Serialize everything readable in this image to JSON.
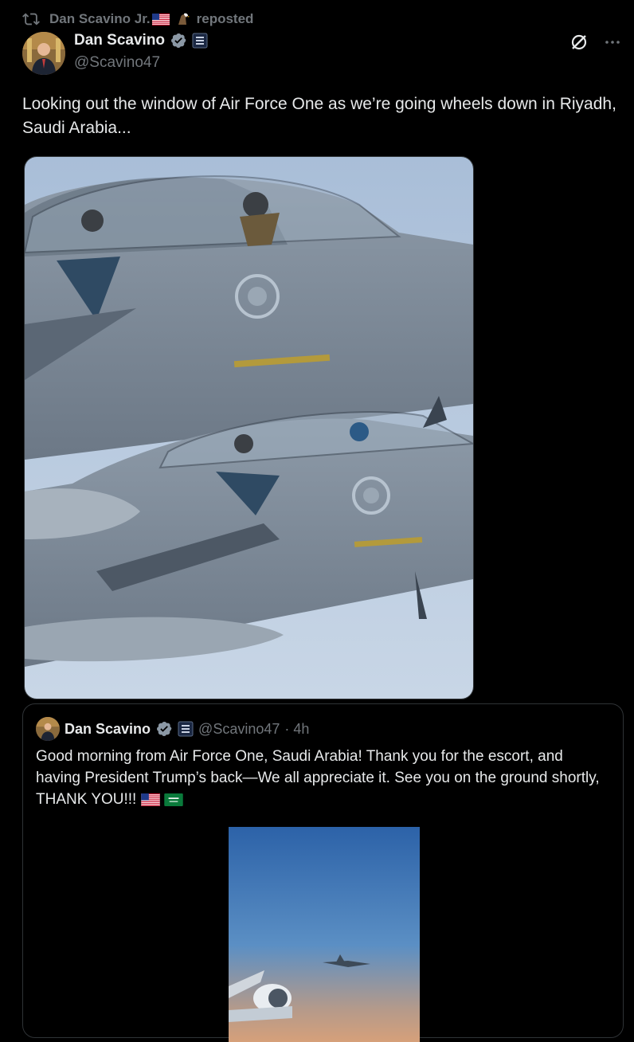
{
  "repost": {
    "reposter": "Dan Scavino Jr.",
    "label": "reposted"
  },
  "author": {
    "name": "Dan Scavino",
    "handle": "@Scavino47"
  },
  "tweet": {
    "text": "Looking out the window of Air Force One as we’re going wheels down in Riyadh, Saudi Arabia..."
  },
  "quote": {
    "name": "Dan Scavino",
    "handle": "@Scavino47",
    "time": "· 4h",
    "text": "Good morning from Air Force One, Saudi Arabia! Thank you for the escort, and having President Trump’s back—We all appreciate it. See you on the ground shortly, THANK YOU!!!"
  },
  "icons": {
    "repost": "repost-icon",
    "verified": "verified-badge-icon",
    "gov": "government-badge-icon",
    "grok": "grok-icon",
    "more": "more-icon"
  },
  "colors": {
    "background": "#000000",
    "text": "#e7e9ea",
    "muted": "#71767b",
    "border": "#2f3336",
    "verified": "#8b98a5"
  }
}
